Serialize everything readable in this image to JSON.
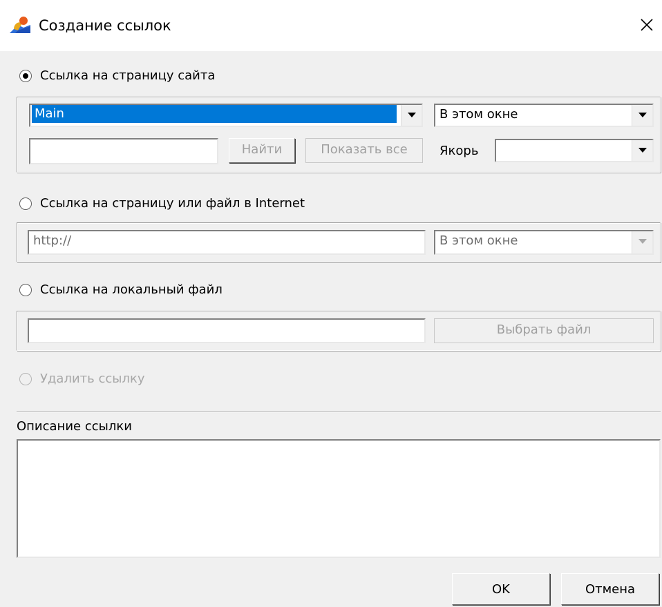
{
  "window": {
    "title": "Создание ссылок",
    "close_symbol": "✕",
    "icon": "app-logo-icon"
  },
  "site_link": {
    "radio_label": "Ссылка на страницу сайта",
    "selected": true,
    "page_select_value": "Main",
    "target_select_value": "В этом окне",
    "search_value": "",
    "find_button": "Найти",
    "show_all_button": "Показать все",
    "anchor_label": "Якорь",
    "anchor_value": ""
  },
  "internet_link": {
    "radio_label": "Ссылка на страницу или файл в Internet",
    "selected": false,
    "url_value": "http://",
    "target_select_value": "В этом окне"
  },
  "local_file_link": {
    "radio_label": "Ссылка на локальный файл",
    "selected": false,
    "path_value": "",
    "choose_button": "Выбрать файл"
  },
  "remove_link": {
    "radio_label": "Удалить ссылку",
    "selected": false,
    "enabled": false
  },
  "description": {
    "label": "Описание ссылки",
    "value": ""
  },
  "footer": {
    "ok_button": "OK",
    "cancel_button": "Отмена"
  },
  "colors": {
    "selection": "#0078d7",
    "dialog_bg": "#f0f0f0"
  }
}
